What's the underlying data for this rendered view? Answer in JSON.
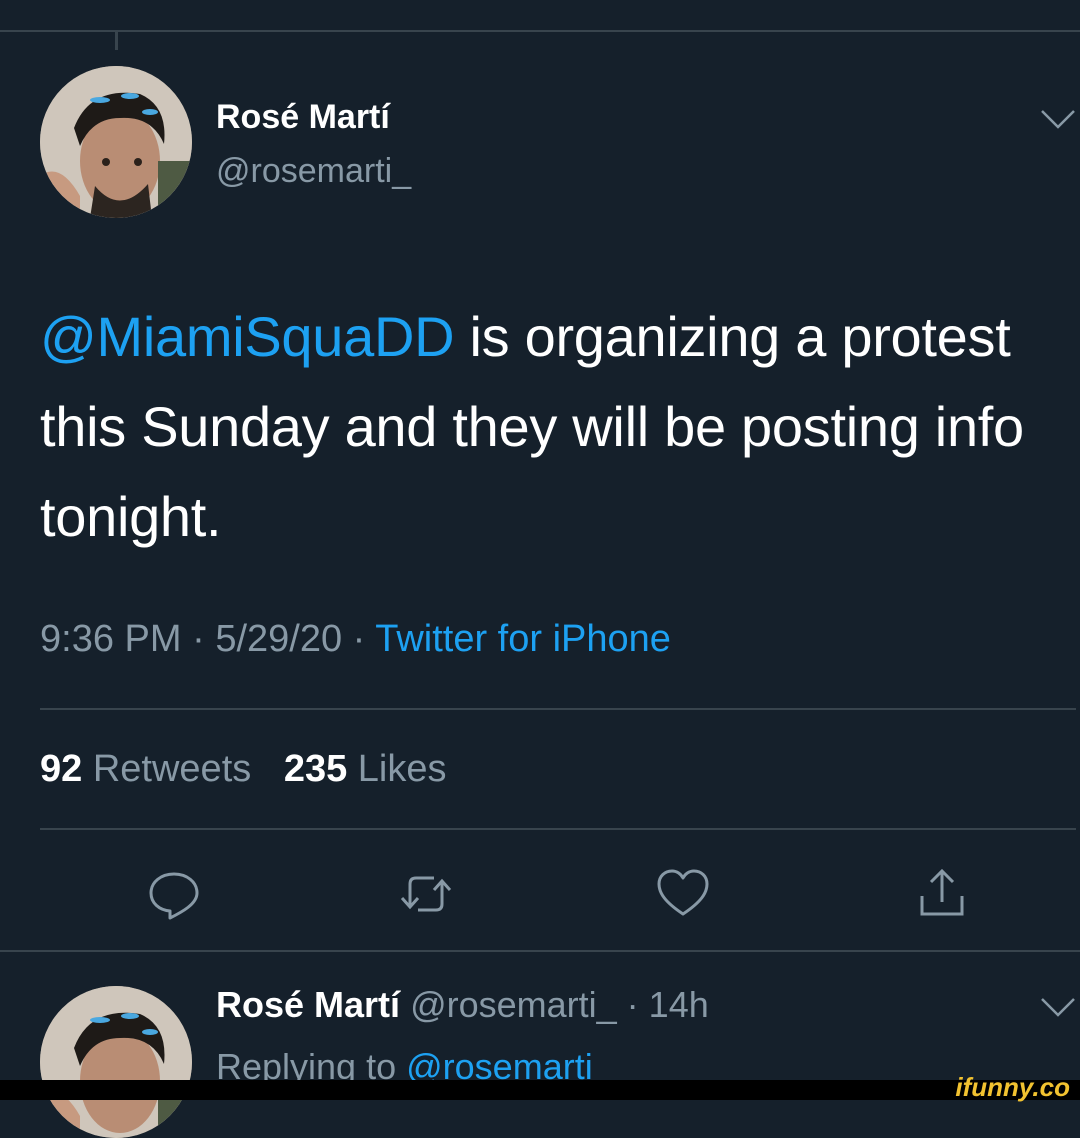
{
  "tweet": {
    "author_name": "Rosé Martí",
    "author_handle": "@rosemarti_",
    "mention": "@MiamiSquaDD",
    "text_rest": " is organizing a protest this Sunday and they will be posting info tonight.",
    "time": "9:36 PM",
    "date": "5/29/20",
    "source": "Twitter for iPhone",
    "separator": " · ",
    "retweets_count": "92",
    "retweets_label": "Retweets",
    "likes_count": "235",
    "likes_label": "Likes"
  },
  "actions": {
    "reply_icon": "reply-icon",
    "retweet_icon": "retweet-icon",
    "like_icon": "heart-icon",
    "share_icon": "share-icon"
  },
  "reply": {
    "author_name": "Rosé Martí",
    "author_handle": "@rosemarti_",
    "age": "14h",
    "replying_label": "Replying to",
    "replying_handle": "@rosemarti_"
  },
  "watermark": "ifunny.co",
  "colors": {
    "background": "#15202b",
    "accent": "#1da1f2",
    "muted": "#8899a6",
    "divider": "#38444d"
  }
}
